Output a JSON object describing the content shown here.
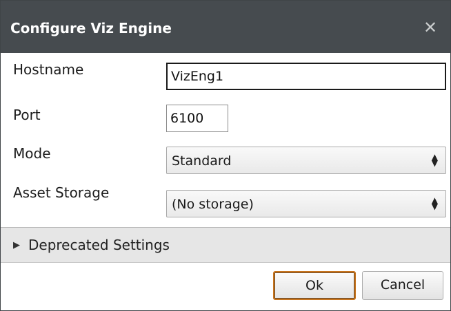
{
  "dialog": {
    "title": "Configure Viz Engine",
    "close_glyph": "✕"
  },
  "form": {
    "hostname_label": "Hostname",
    "hostname_value": "VizEng1",
    "port_label": "Port",
    "port_value": "6100",
    "mode_label": "Mode",
    "mode_value": "Standard",
    "asset_label": "Asset Storage",
    "asset_value": "(No storage)"
  },
  "expander": {
    "label": "Deprecated Settings",
    "glyph": "▶"
  },
  "buttons": {
    "ok_label": "Ok",
    "cancel_label": "Cancel"
  },
  "colors": {
    "titlebar": "#464b4f",
    "ok_focus_border": "#c8741c",
    "expander_bg": "#e6e6e6"
  },
  "icons": {
    "close": "close-icon",
    "dropdown": "updown-arrow-icon",
    "expander": "triangle-right-icon"
  }
}
